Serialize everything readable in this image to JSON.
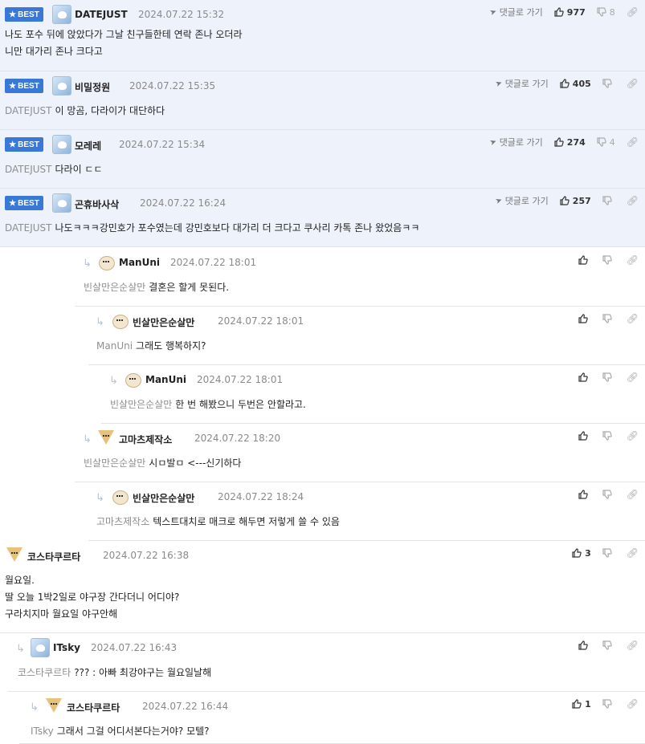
{
  "labels": {
    "best": "BEST",
    "goto": "댓글로 가기"
  },
  "comments": [
    {
      "nick": "DATEJUST",
      "date": "2024.07.22 15:32",
      "best": true,
      "avatar": "blue",
      "up": "977",
      "down": "8",
      "reply_to": "",
      "lines": [
        "나도 포수 뒤에 앉았다가 그날 친구들한테 연락 존나 오더라",
        "니만 대가리 존나 크다고"
      ]
    },
    {
      "nick": "비밀정원",
      "date": "2024.07.22 15:35",
      "best": true,
      "avatar": "blue",
      "up": "405",
      "down": "",
      "reply_to": "DATEJUST",
      "lines": [
        "이 망곰, 다라이가 대단하다"
      ]
    },
    {
      "nick": "모레레",
      "date": "2024.07.22 15:34",
      "best": true,
      "avatar": "blue",
      "up": "274",
      "down": "4",
      "reply_to": "DATEJUST",
      "lines": [
        "다라이 ㄷㄷ"
      ]
    },
    {
      "nick": "곤휴바사삭",
      "date": "2024.07.22 16:24",
      "best": true,
      "avatar": "blue",
      "up": "257",
      "down": "",
      "reply_to": "DATEJUST",
      "lines": [
        "나도ㅋㅋㅋ강민호가 포수였는데 강민호보다 대가리 더 크다고 쿠사리 카톡 존나 왔었음ㅋㅋ"
      ]
    },
    {
      "nick": "ManUni",
      "date": "2024.07.22 18:01",
      "best": false,
      "avatar": "dog",
      "up": "",
      "down": "",
      "reply_to": "빈살만은순살만",
      "lines": [
        "결혼은 할게 못된다."
      ]
    },
    {
      "nick": "빈살만은순살만",
      "date": "2024.07.22 18:01",
      "best": false,
      "avatar": "dog",
      "up": "",
      "down": "",
      "reply_to": "ManUni",
      "lines": [
        "그래도 행복하지?"
      ]
    },
    {
      "nick": "ManUni",
      "date": "2024.07.22 18:01",
      "best": false,
      "avatar": "dog",
      "up": "",
      "down": "",
      "reply_to": "빈살만은순살만",
      "lines": [
        "한 번 해봤으니 두번은 안할라고."
      ]
    },
    {
      "nick": "고마츠제작소",
      "date": "2024.07.22 18:20",
      "best": false,
      "avatar": "fox",
      "up": "",
      "down": "",
      "reply_to": "빈살만은순살만",
      "lines": [
        "시ㅁ발ㅁ <---신기하다"
      ]
    },
    {
      "nick": "빈살만은순살만",
      "date": "2024.07.22 18:24",
      "best": false,
      "avatar": "dog",
      "up": "",
      "down": "",
      "reply_to": "고마츠제작소",
      "lines": [
        "텍스트대치로 매크로 해두면 저렇게 쓸 수 있음"
      ]
    },
    {
      "nick": "코스타쿠르타",
      "date": "2024.07.22 16:38",
      "best": false,
      "avatar": "fox",
      "up": "3",
      "down": "",
      "reply_to": "",
      "lines": [
        "월요일.",
        "딸 오늘 1박2일로 야구장 간다더니 어디야?",
        "구라치지마 월요일 야구안해"
      ]
    },
    {
      "nick": "ITsky",
      "date": "2024.07.22 16:43",
      "best": false,
      "avatar": "blue",
      "up": "",
      "down": "",
      "reply_to": "코스타쿠르타",
      "lines": [
        "??? : 아빠 최강야구는 월요일날해"
      ]
    },
    {
      "nick": "코스타쿠르타",
      "date": "2024.07.22 16:44",
      "best": false,
      "avatar": "fox",
      "up": "1",
      "down": "",
      "reply_to": "ITsky",
      "lines": [
        "그래서 그걸 어디서본다는거야? 모텔?"
      ]
    }
  ]
}
